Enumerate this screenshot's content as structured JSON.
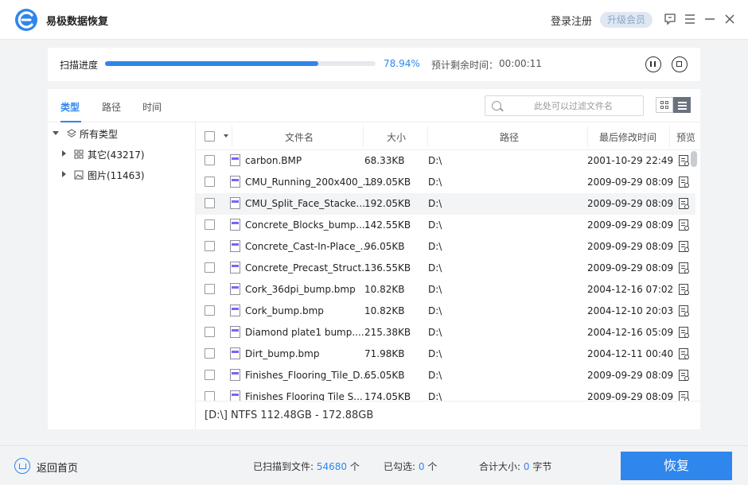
{
  "app": {
    "title": "易极数据恢复",
    "login_label": "登录注册",
    "vip_label": "升级会员"
  },
  "titlebar_icons": [
    "feedback-icon",
    "menu-icon",
    "minimize-icon",
    "close-icon"
  ],
  "progress": {
    "label": "扫描进度",
    "percent_text": "78.94%",
    "fraction": 0.7894,
    "eta_label": "预计剩余时间：",
    "eta_value": "00:00:11"
  },
  "tabs": [
    {
      "label": "类型",
      "active": true
    },
    {
      "label": "路径",
      "active": false
    },
    {
      "label": "时间",
      "active": false
    }
  ],
  "filter": {
    "placeholder": "此处可以过滤文件名"
  },
  "tree": {
    "root": {
      "label": "所有类型"
    },
    "children": [
      {
        "label": "其它(43217)",
        "icon": "grid-icon"
      },
      {
        "label": "图片(11463)",
        "icon": "image-icon"
      }
    ]
  },
  "table": {
    "columns": [
      "文件名",
      "大小",
      "路径",
      "最后修改时间",
      "预览"
    ],
    "rows": [
      {
        "name": "carbon.BMP",
        "size": "68.33KB",
        "path": "D:\\",
        "time": "2001-10-29 22:49",
        "highlight": false
      },
      {
        "name": "CMU_Running_200x400_...",
        "size": "189.05KB",
        "path": "D:\\",
        "time": "2009-09-29 08:09",
        "highlight": false
      },
      {
        "name": "CMU_Split_Face_Stacke...",
        "size": "192.05KB",
        "path": "D:\\",
        "time": "2009-09-29 08:09",
        "highlight": true
      },
      {
        "name": "Concrete_Blocks_bump....",
        "size": "142.55KB",
        "path": "D:\\",
        "time": "2009-09-29 08:09",
        "highlight": false
      },
      {
        "name": "Concrete_Cast-In-Place_...",
        "size": "96.05KB",
        "path": "D:\\",
        "time": "2009-09-29 08:09",
        "highlight": false
      },
      {
        "name": "Concrete_Precast_Struct...",
        "size": "136.55KB",
        "path": "D:\\",
        "time": "2009-09-29 08:09",
        "highlight": false
      },
      {
        "name": "Cork_36dpi_bump.bmp",
        "size": "10.82KB",
        "path": "D:\\",
        "time": "2004-12-16 07:02",
        "highlight": false
      },
      {
        "name": "Cork_bump.bmp",
        "size": "10.82KB",
        "path": "D:\\",
        "time": "2004-12-10 20:03",
        "highlight": false
      },
      {
        "name": "Diamond plate1 bump....",
        "size": "215.38KB",
        "path": "D:\\",
        "time": "2004-12-16 05:09",
        "highlight": false
      },
      {
        "name": "Dirt_bump.bmp",
        "size": "71.98KB",
        "path": "D:\\",
        "time": "2004-12-11 00:40",
        "highlight": false
      },
      {
        "name": "Finishes_Flooring_Tile_D...",
        "size": "65.05KB",
        "path": "D:\\",
        "time": "2009-09-29 08:09",
        "highlight": false
      },
      {
        "name": "Finishes Flooring Tile S...",
        "size": "174.05KB",
        "path": "D:\\",
        "time": "2009-09-29 08:09",
        "highlight": false
      }
    ]
  },
  "disk_info": "[D:\\] NTFS 112.48GB - 172.88GB",
  "footer": {
    "home_label": "返回首页",
    "scanned_label": "已扫描到文件:",
    "scanned_count": "54680",
    "scanned_unit": "个",
    "selected_label": "已勾选:",
    "selected_count": "0",
    "selected_unit": "个",
    "total_label": "合计大小:",
    "total_size": "0",
    "total_unit": "字节",
    "recover_label": "恢复"
  },
  "colors": {
    "accent": "#2f86ec",
    "vip_bg": "#dfe7f3"
  }
}
